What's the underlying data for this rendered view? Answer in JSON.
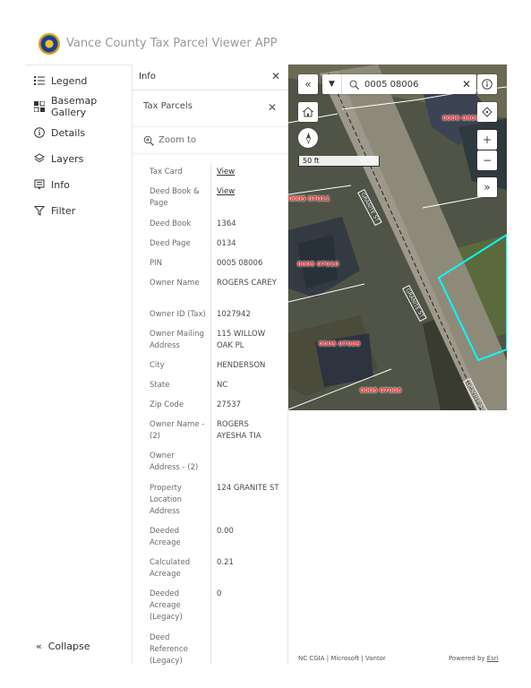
{
  "app": {
    "title": "Vance County Tax Parcel Viewer APP"
  },
  "sidebar": {
    "items": [
      {
        "label": "Legend",
        "icon": "legend-icon"
      },
      {
        "label": "Basemap Gallery",
        "icon": "basemap-gallery-icon"
      },
      {
        "label": "Details",
        "icon": "info-circle-icon"
      },
      {
        "label": "Layers",
        "icon": "layers-icon"
      },
      {
        "label": "Info",
        "icon": "popup-icon"
      },
      {
        "label": "Filter",
        "icon": "filter-icon"
      }
    ],
    "collapse_label": "Collapse"
  },
  "panel": {
    "title": "Info",
    "layer_name": "Tax Parcels",
    "zoom_label": "Zoom to",
    "attributes": [
      {
        "key": "Tax Card",
        "value": "View",
        "link": true
      },
      {
        "key": "Deed Book & Page",
        "value": "View",
        "link": true
      },
      {
        "key": "Deed Book",
        "value": "1364"
      },
      {
        "key": "Deed Page",
        "value": "0134"
      },
      {
        "key": "PIN",
        "value": "0005 08006"
      },
      {
        "key": "Owner Name",
        "value": "ROGERS CAREY"
      },
      {
        "key": "Owner ID (Tax)",
        "value": "1027942"
      },
      {
        "key": "Owner Mailing Address",
        "value": "115 WILLOW OAK PL"
      },
      {
        "key": "City",
        "value": "HENDERSON"
      },
      {
        "key": "State",
        "value": "NC"
      },
      {
        "key": "Zip Code",
        "value": "27537"
      },
      {
        "key": "Owner Name - (2)",
        "value": "ROGERS AYESHA TIA"
      },
      {
        "key": "Owner Address - (2)",
        "value": ""
      },
      {
        "key": "Property Location Address",
        "value": "124 GRANITE ST"
      },
      {
        "key": "Deeded Acreage",
        "value": "0.00"
      },
      {
        "key": "Calculated Acreage",
        "value": "0.21"
      },
      {
        "key": "Deeded Acreage (Legacy)",
        "value": "0"
      },
      {
        "key": "Deed Reference (Legacy)",
        "value": ""
      }
    ]
  },
  "map": {
    "search_value": "0005 08006",
    "scale_label": "50 ft",
    "parcel_labels": [
      "0005 07011",
      "0005 07010",
      "0005 07009",
      "0005 07008",
      "0006 08006"
    ],
    "street_label": "GRANITE ST",
    "attribution": "NC CGIA | Microsoft | Vantor",
    "powered_prefix": "Powered by ",
    "powered_link": "Esri",
    "colors": {
      "selection": "#00ffff",
      "parcel_label": "#ff2a2a"
    }
  }
}
